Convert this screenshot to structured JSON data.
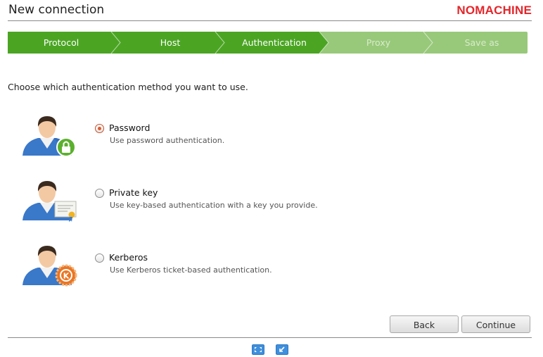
{
  "header": {
    "title": "New connection",
    "logo_text": "NOMACHINE"
  },
  "steps": [
    {
      "label": "Protocol",
      "active": true
    },
    {
      "label": "Host",
      "active": true
    },
    {
      "label": "Authentication",
      "active": true
    },
    {
      "label": "Proxy",
      "active": false
    },
    {
      "label": "Save as",
      "active": false
    }
  ],
  "prompt": "Choose which authentication method you want to use.",
  "options": [
    {
      "label": "Password",
      "description": "Use password authentication.",
      "selected": true,
      "badge_icon": "lock-icon"
    },
    {
      "label": "Private key",
      "description": "Use key-based authentication with a key you provide.",
      "selected": false,
      "badge_icon": "certificate-icon"
    },
    {
      "label": "Kerberos",
      "description": "Use Kerberos ticket-based authentication.",
      "selected": false,
      "badge_icon": "kerberos-icon"
    }
  ],
  "buttons": {
    "back": "Back",
    "continue": "Continue"
  },
  "colors": {
    "step_active": "#4ba523",
    "step_inactive": "#98c97a",
    "logo": "#e4262b",
    "radio_selected": "#e25a2c"
  }
}
